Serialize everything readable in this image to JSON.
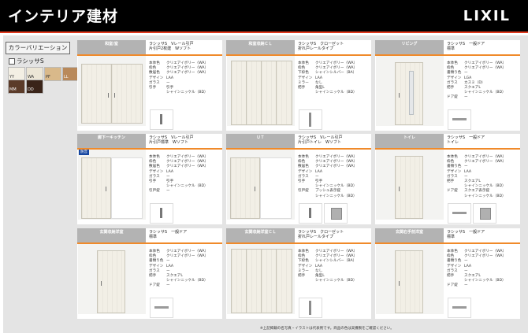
{
  "header": {
    "title": "インテリア建材",
    "brand": "LIXIL"
  },
  "sidebar": {
    "variation_button": "カラーバリエーション",
    "series_label": "ラシッサS",
    "swatches": [
      {
        "code": "YY",
        "color": "#f3efe4"
      },
      {
        "code": "WA",
        "color": "#ece6d6"
      },
      {
        "code": "PF",
        "color": "#d9b98a"
      },
      {
        "code": "LL",
        "color": "#b9895a"
      },
      {
        "code": "MM",
        "color": "#5b3b29"
      },
      {
        "code": "DD",
        "color": "#3a2419"
      }
    ]
  },
  "cards": [
    {
      "room": "和室/室",
      "badge": "",
      "product": [
        "ラシッサS　Vレール引戸",
        "片引戸2枚建　Wソフト"
      ],
      "specs": [
        [
          "本体色",
          "クリエアイボリー（WA）"
        ],
        [
          "枠色",
          "クリエアイボリー（WA）"
        ],
        [
          "敷居色",
          "クリエアイボリー（WA）"
        ],
        [
          "デザイン",
          "LAA"
        ],
        [
          "ガラス",
          "ー"
        ],
        [
          "引手",
          "引手"
        ],
        [
          "",
          "シャインニッケル（BD）"
        ]
      ]
    },
    {
      "room": "和室収納ＣＬ",
      "badge": "",
      "product": [
        "ラシッサS　クローゼット",
        "折れ戸レールタイプ"
      ],
      "specs": [
        [
          "本体色",
          "クリエアイボリー（WA）"
        ],
        [
          "枠色",
          "クリエアイボリー（WA）"
        ],
        [
          "下枠色",
          "シャインシルバー（BA）"
        ],
        [
          "デザイン",
          "LAA"
        ],
        [
          "ミラー",
          "なし"
        ],
        [
          "把手",
          "角型L"
        ],
        [
          "",
          "シャインニッケル（BD）"
        ]
      ]
    },
    {
      "room": "リビング",
      "badge": "",
      "product": [
        "ラシッサS　一般ドア",
        "標準"
      ],
      "specs": [
        [
          "本体色",
          "クリエアイボリー（WA）"
        ],
        [
          "枠色",
          "クリエアイボリー（WA）"
        ],
        [
          "書類り色",
          "ー"
        ],
        [
          "デザイン",
          "LGA"
        ],
        [
          "ガラス",
          "カスミ（D）"
        ],
        [
          "把手",
          "スクエアL"
        ],
        [
          "",
          "シャインニッケル（BD）"
        ],
        [
          "ドア錠",
          "ー"
        ]
      ]
    },
    {
      "room": "廊下ーキッチン",
      "badge": "防音",
      "product": [
        "ラシッサS　Vレール引戸",
        "片引戸標準　Wソフト"
      ],
      "specs": [
        [
          "本体色",
          "クリエアイボリー（WA）"
        ],
        [
          "枠色",
          "クリエアイボリー（WA）"
        ],
        [
          "敷居色",
          "クリエアイボリー（WA）"
        ],
        [
          "デザイン",
          "LAA"
        ],
        [
          "ガラス",
          "ー"
        ],
        [
          "引手",
          "引手"
        ],
        [
          "",
          "シャインニッケル（BD）"
        ],
        [
          "引戸錠",
          "ー"
        ]
      ]
    },
    {
      "room": "ＵＴ",
      "badge": "",
      "product": [
        "ラシッサS　Vレール引戸",
        "片引戸トイレ　Wソフト"
      ],
      "specs": [
        [
          "本体色",
          "クリエアイボリー（WA）"
        ],
        [
          "枠色",
          "クリエアイボリー（WA）"
        ],
        [
          "敷居色",
          "クリエアイボリー（WA）"
        ],
        [
          "デザイン",
          "LAA"
        ],
        [
          "ガラス",
          "ー"
        ],
        [
          "引手",
          "引手"
        ],
        [
          "",
          "シャインニッケル（BD）"
        ],
        [
          "引戸錠",
          "プッシュ表示錠"
        ],
        [
          "",
          "シャインニッケル（BD）"
        ]
      ]
    },
    {
      "room": "トイレ",
      "badge": "",
      "product": [
        "ラシッサS　一般ドア",
        "トイレ"
      ],
      "specs": [
        [
          "本体色",
          "クリエアイボリー（WA）"
        ],
        [
          "枠色",
          "クリエアイボリー（WA）"
        ],
        [
          "書類り色",
          "ー"
        ],
        [
          "デザイン",
          "LAA"
        ],
        [
          "ガラス",
          "ー"
        ],
        [
          "把手",
          "スクエアL"
        ],
        [
          "",
          "シャインニッケル（BD）"
        ],
        [
          "ドア錠",
          "スクエア表示錠"
        ],
        [
          "",
          "シャインニッケル（BD）"
        ]
      ]
    },
    {
      "room": "玄関収納洋室",
      "badge": "",
      "product": [
        "ラシッサS　一般ドア",
        "標準"
      ],
      "specs": [
        [
          "本体色",
          "クリエアイボリー（WA）"
        ],
        [
          "枠色",
          "クリエアイボリー（WA）"
        ],
        [
          "書類り色",
          "ー"
        ],
        [
          "デザイン",
          "LAA"
        ],
        [
          "ガラス",
          "ー"
        ],
        [
          "把手",
          "スクエアL"
        ],
        [
          "",
          "シャインニッケル（BD）"
        ],
        [
          "ドア錠",
          "ー"
        ]
      ]
    },
    {
      "room": "玄関収納洋室ＣＬ",
      "badge": "",
      "product": [
        "ラシッサS　クローゼット",
        "折れ戸レールタイプ"
      ],
      "specs": [
        [
          "本体色",
          "クリエアイボリー（WA）"
        ],
        [
          "枠色",
          "クリエアイボリー（WA）"
        ],
        [
          "下枠色",
          "シャインシルバー（BA）"
        ],
        [
          "デザイン",
          "LAA"
        ],
        [
          "ミラー",
          "なし"
        ],
        [
          "把手",
          "角型L"
        ],
        [
          "",
          "シャインニッケル（BD）"
        ]
      ]
    },
    {
      "room": "玄関右手前洋室",
      "badge": "",
      "product": [
        "ラシッサS　一般ドア",
        "標準"
      ],
      "specs": [
        [
          "本体色",
          "クリエアイボリー（WA）"
        ],
        [
          "枠色",
          "クリエアイボリー（WA）"
        ],
        [
          "書類り色",
          "ー"
        ],
        [
          "デザイン",
          "LAA"
        ],
        [
          "ガラス",
          "ー"
        ],
        [
          "把手",
          "スクエアL"
        ],
        [
          "",
          "シャインニッケル（BD）"
        ],
        [
          "ドア錠",
          "ー"
        ]
      ]
    }
  ],
  "footnote": "※上記掲載の名写真・イラストは代表例です。商品の色は実機製をご確認ください。"
}
